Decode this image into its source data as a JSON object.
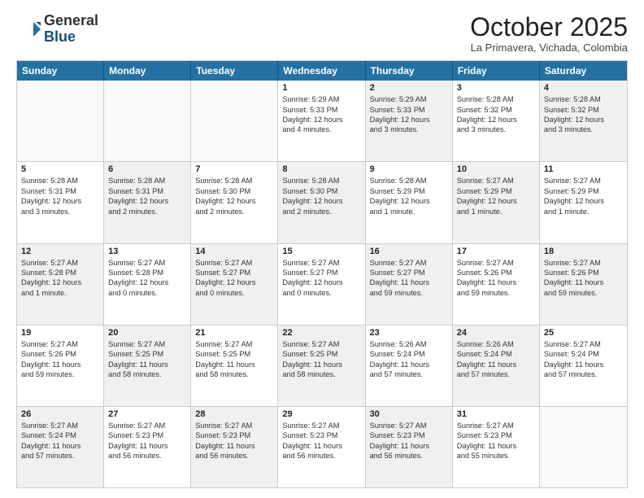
{
  "header": {
    "logo_general": "General",
    "logo_blue": "Blue",
    "month_title": "October 2025",
    "location": "La Primavera, Vichada, Colombia"
  },
  "days_of_week": [
    "Sunday",
    "Monday",
    "Tuesday",
    "Wednesday",
    "Thursday",
    "Friday",
    "Saturday"
  ],
  "rows": [
    [
      {
        "day": "",
        "lines": [],
        "empty": true
      },
      {
        "day": "",
        "lines": [],
        "empty": true
      },
      {
        "day": "",
        "lines": [],
        "empty": true
      },
      {
        "day": "1",
        "lines": [
          "Sunrise: 5:29 AM",
          "Sunset: 5:33 PM",
          "Daylight: 12 hours",
          "and 4 minutes."
        ]
      },
      {
        "day": "2",
        "lines": [
          "Sunrise: 5:29 AM",
          "Sunset: 5:33 PM",
          "Daylight: 12 hours",
          "and 3 minutes."
        ],
        "shaded": true
      },
      {
        "day": "3",
        "lines": [
          "Sunrise: 5:28 AM",
          "Sunset: 5:32 PM",
          "Daylight: 12 hours",
          "and 3 minutes."
        ]
      },
      {
        "day": "4",
        "lines": [
          "Sunrise: 5:28 AM",
          "Sunset: 5:32 PM",
          "Daylight: 12 hours",
          "and 3 minutes."
        ],
        "shaded": true
      }
    ],
    [
      {
        "day": "5",
        "lines": [
          "Sunrise: 5:28 AM",
          "Sunset: 5:31 PM",
          "Daylight: 12 hours",
          "and 3 minutes."
        ]
      },
      {
        "day": "6",
        "lines": [
          "Sunrise: 5:28 AM",
          "Sunset: 5:31 PM",
          "Daylight: 12 hours",
          "and 2 minutes."
        ],
        "shaded": true
      },
      {
        "day": "7",
        "lines": [
          "Sunrise: 5:28 AM",
          "Sunset: 5:30 PM",
          "Daylight: 12 hours",
          "and 2 minutes."
        ]
      },
      {
        "day": "8",
        "lines": [
          "Sunrise: 5:28 AM",
          "Sunset: 5:30 PM",
          "Daylight: 12 hours",
          "and 2 minutes."
        ],
        "shaded": true
      },
      {
        "day": "9",
        "lines": [
          "Sunrise: 5:28 AM",
          "Sunset: 5:29 PM",
          "Daylight: 12 hours",
          "and 1 minute."
        ]
      },
      {
        "day": "10",
        "lines": [
          "Sunrise: 5:27 AM",
          "Sunset: 5:29 PM",
          "Daylight: 12 hours",
          "and 1 minute."
        ],
        "shaded": true
      },
      {
        "day": "11",
        "lines": [
          "Sunrise: 5:27 AM",
          "Sunset: 5:29 PM",
          "Daylight: 12 hours",
          "and 1 minute."
        ]
      }
    ],
    [
      {
        "day": "12",
        "lines": [
          "Sunrise: 5:27 AM",
          "Sunset: 5:28 PM",
          "Daylight: 12 hours",
          "and 1 minute."
        ],
        "shaded": true
      },
      {
        "day": "13",
        "lines": [
          "Sunrise: 5:27 AM",
          "Sunset: 5:28 PM",
          "Daylight: 12 hours",
          "and 0 minutes."
        ]
      },
      {
        "day": "14",
        "lines": [
          "Sunrise: 5:27 AM",
          "Sunset: 5:27 PM",
          "Daylight: 12 hours",
          "and 0 minutes."
        ],
        "shaded": true
      },
      {
        "day": "15",
        "lines": [
          "Sunrise: 5:27 AM",
          "Sunset: 5:27 PM",
          "Daylight: 12 hours",
          "and 0 minutes."
        ]
      },
      {
        "day": "16",
        "lines": [
          "Sunrise: 5:27 AM",
          "Sunset: 5:27 PM",
          "Daylight: 11 hours",
          "and 59 minutes."
        ],
        "shaded": true
      },
      {
        "day": "17",
        "lines": [
          "Sunrise: 5:27 AM",
          "Sunset: 5:26 PM",
          "Daylight: 11 hours",
          "and 59 minutes."
        ]
      },
      {
        "day": "18",
        "lines": [
          "Sunrise: 5:27 AM",
          "Sunset: 5:26 PM",
          "Daylight: 11 hours",
          "and 59 minutes."
        ],
        "shaded": true
      }
    ],
    [
      {
        "day": "19",
        "lines": [
          "Sunrise: 5:27 AM",
          "Sunset: 5:26 PM",
          "Daylight: 11 hours",
          "and 59 minutes."
        ]
      },
      {
        "day": "20",
        "lines": [
          "Sunrise: 5:27 AM",
          "Sunset: 5:25 PM",
          "Daylight: 11 hours",
          "and 58 minutes."
        ],
        "shaded": true
      },
      {
        "day": "21",
        "lines": [
          "Sunrise: 5:27 AM",
          "Sunset: 5:25 PM",
          "Daylight: 11 hours",
          "and 58 minutes."
        ]
      },
      {
        "day": "22",
        "lines": [
          "Sunrise: 5:27 AM",
          "Sunset: 5:25 PM",
          "Daylight: 11 hours",
          "and 58 minutes."
        ],
        "shaded": true
      },
      {
        "day": "23",
        "lines": [
          "Sunrise: 5:26 AM",
          "Sunset: 5:24 PM",
          "Daylight: 11 hours",
          "and 57 minutes."
        ]
      },
      {
        "day": "24",
        "lines": [
          "Sunrise: 5:26 AM",
          "Sunset: 5:24 PM",
          "Daylight: 11 hours",
          "and 57 minutes."
        ],
        "shaded": true
      },
      {
        "day": "25",
        "lines": [
          "Sunrise: 5:27 AM",
          "Sunset: 5:24 PM",
          "Daylight: 11 hours",
          "and 57 minutes."
        ]
      }
    ],
    [
      {
        "day": "26",
        "lines": [
          "Sunrise: 5:27 AM",
          "Sunset: 5:24 PM",
          "Daylight: 11 hours",
          "and 57 minutes."
        ],
        "shaded": true
      },
      {
        "day": "27",
        "lines": [
          "Sunrise: 5:27 AM",
          "Sunset: 5:23 PM",
          "Daylight: 11 hours",
          "and 56 minutes."
        ]
      },
      {
        "day": "28",
        "lines": [
          "Sunrise: 5:27 AM",
          "Sunset: 5:23 PM",
          "Daylight: 11 hours",
          "and 56 minutes."
        ],
        "shaded": true
      },
      {
        "day": "29",
        "lines": [
          "Sunrise: 5:27 AM",
          "Sunset: 5:23 PM",
          "Daylight: 11 hours",
          "and 56 minutes."
        ]
      },
      {
        "day": "30",
        "lines": [
          "Sunrise: 5:27 AM",
          "Sunset: 5:23 PM",
          "Daylight: 11 hours",
          "and 56 minutes."
        ],
        "shaded": true
      },
      {
        "day": "31",
        "lines": [
          "Sunrise: 5:27 AM",
          "Sunset: 5:23 PM",
          "Daylight: 11 hours",
          "and 55 minutes."
        ]
      },
      {
        "day": "",
        "lines": [],
        "empty": true
      }
    ]
  ]
}
